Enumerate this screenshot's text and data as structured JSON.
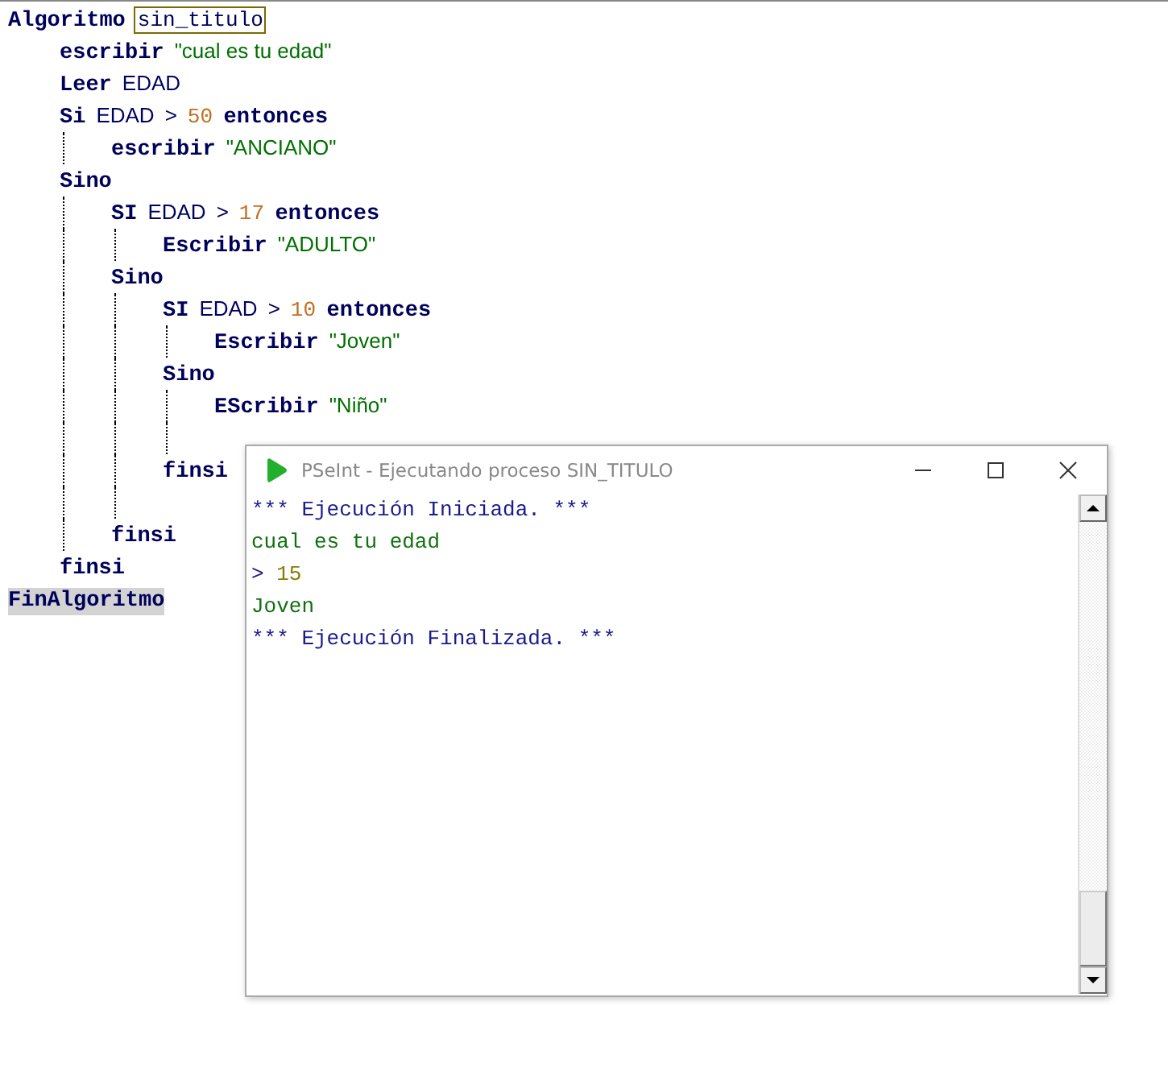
{
  "code": [
    {
      "tokens": [
        {
          "kind": "keyword",
          "text": "Algoritmo"
        },
        {
          "kind": "match",
          "text": "sin_titulo"
        }
      ],
      "children": [
        {
          "tokens": [
            {
              "kind": "keyword",
              "text": "escribir"
            },
            {
              "kind": "string",
              "text": "\"cual es tu edad\""
            }
          ]
        },
        {
          "tokens": [
            {
              "kind": "keyword",
              "text": "Leer"
            },
            {
              "kind": "ident",
              "text": "EDAD"
            }
          ]
        },
        {
          "tokens": [
            {
              "kind": "keyword",
              "text": "Si"
            },
            {
              "kind": "ident",
              "text": "EDAD"
            },
            {
              "kind": "op",
              "text": ">"
            },
            {
              "kind": "number",
              "text": "50"
            },
            {
              "kind": "keyword",
              "text": "entonces"
            }
          ],
          "children": [
            {
              "tokens": [
                {
                  "kind": "keyword",
                  "text": "escribir"
                },
                {
                  "kind": "string",
                  "text": "\"ANCIANO\""
                }
              ]
            }
          ]
        },
        {
          "tokens": [
            {
              "kind": "keyword",
              "text": "Sino"
            }
          ],
          "children": [
            {
              "tokens": [
                {
                  "kind": "keyword",
                  "text": "SI"
                },
                {
                  "kind": "ident",
                  "text": "EDAD"
                },
                {
                  "kind": "op",
                  "text": ">"
                },
                {
                  "kind": "number",
                  "text": "17"
                },
                {
                  "kind": "keyword",
                  "text": "entonces"
                }
              ],
              "children": [
                {
                  "tokens": [
                    {
                      "kind": "keyword",
                      "text": "Escribir"
                    },
                    {
                      "kind": "string",
                      "text": "\"ADULTO\""
                    }
                  ]
                }
              ]
            },
            {
              "tokens": [
                {
                  "kind": "keyword",
                  "text": "Sino"
                }
              ],
              "children": [
                {
                  "tokens": [
                    {
                      "kind": "keyword",
                      "text": "SI"
                    },
                    {
                      "kind": "ident",
                      "text": "EDAD"
                    },
                    {
                      "kind": "op",
                      "text": ">"
                    },
                    {
                      "kind": "number",
                      "text": "10"
                    },
                    {
                      "kind": "keyword",
                      "text": "entonces"
                    }
                  ],
                  "children": [
                    {
                      "tokens": [
                        {
                          "kind": "keyword",
                          "text": "Escribir"
                        },
                        {
                          "kind": "string",
                          "text": "\"Joven\""
                        }
                      ]
                    }
                  ]
                },
                {
                  "tokens": [
                    {
                      "kind": "keyword",
                      "text": "Sino"
                    }
                  ],
                  "children": [
                    {
                      "tokens": [
                        {
                          "kind": "keyword",
                          "text": "EScribir"
                        },
                        {
                          "kind": "string",
                          "text": "\"Niño\""
                        }
                      ]
                    },
                    {
                      "kind": "blank"
                    }
                  ]
                },
                {
                  "tokens": [
                    {
                      "kind": "keyword",
                      "text": "finsi"
                    }
                  ]
                },
                {
                  "kind": "blank"
                }
              ]
            },
            {
              "tokens": [
                {
                  "kind": "keyword",
                  "text": "finsi"
                }
              ]
            }
          ]
        },
        {
          "tokens": [
            {
              "kind": "keyword",
              "text": "finsi"
            }
          ]
        }
      ]
    },
    {
      "tokens": [
        {
          "kind": "highlight",
          "text": "FinAlgoritmo"
        }
      ]
    }
  ],
  "console": {
    "title": "PSeInt - Ejecutando proceso SIN_TITULO",
    "lines": [
      {
        "kind": "system",
        "text": "*** Ejecución Iniciada. ***"
      },
      {
        "kind": "output",
        "text": "cual es tu edad"
      },
      {
        "kind": "input",
        "prompt": ">",
        "text": "15"
      },
      {
        "kind": "output",
        "text": "Joven"
      },
      {
        "kind": "system",
        "text": "*** Ejecución Finalizada. ***"
      }
    ]
  }
}
